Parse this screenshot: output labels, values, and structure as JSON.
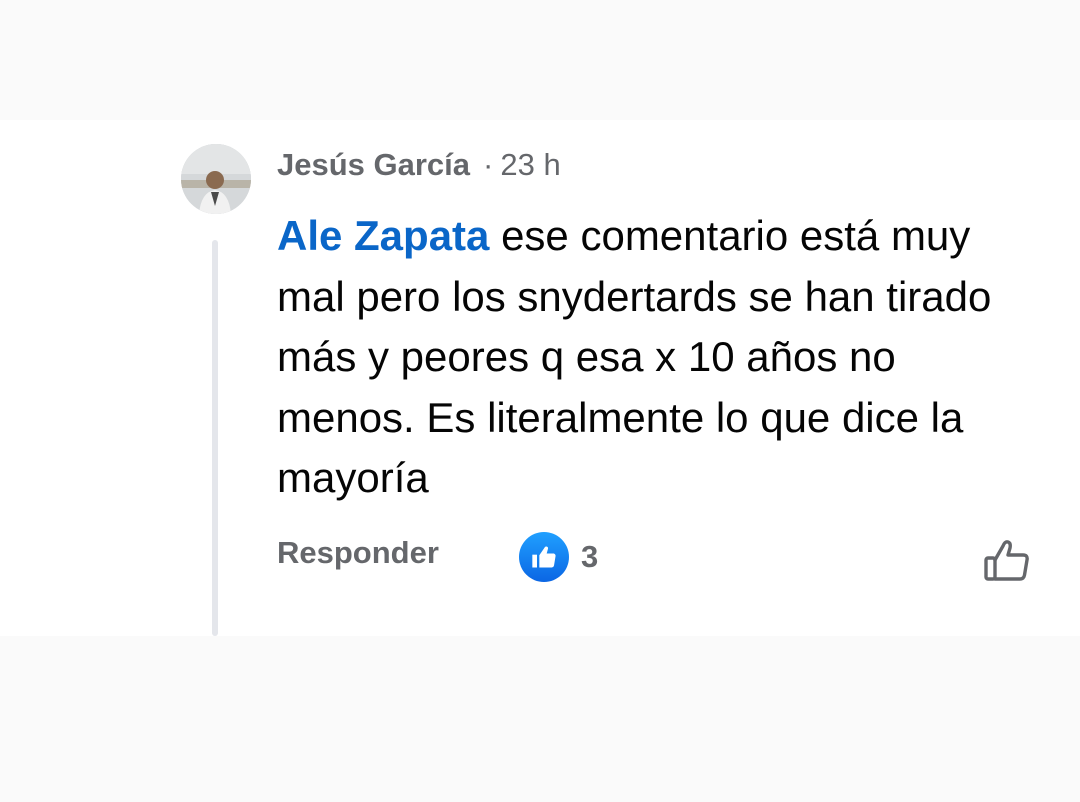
{
  "comment": {
    "author": "Jesús García",
    "separator": "·",
    "time": "23 h",
    "mention": "Ale Zapata",
    "text": " ese comentario está muy mal pero los snydertards se han tirado más y peores q esa x 10 años no menos. Es literalmente lo que dice la mayoría"
  },
  "actions": {
    "reply_label": "Responder",
    "reaction_icon": "like-reaction-icon",
    "reaction_count": "3",
    "like_button_icon": "thumbs-up-outline-icon"
  },
  "colors": {
    "mention": "#0a66c8",
    "meta_text": "#65676b",
    "body_text": "#050505",
    "like_badge": "#1877f2",
    "thread_line": "#e4e6eb",
    "background": "#fafafa"
  }
}
